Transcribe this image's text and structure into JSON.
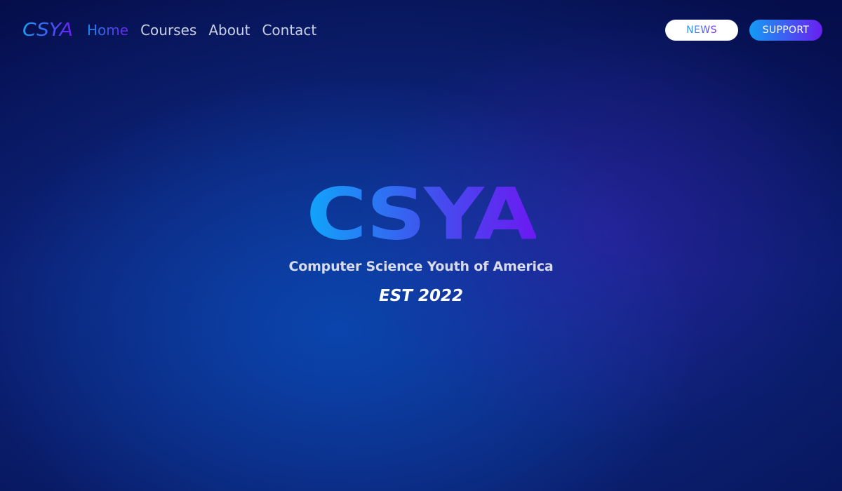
{
  "brand": {
    "logo_text": "CSYA"
  },
  "nav": {
    "links": [
      {
        "label": "Home",
        "active": true
      },
      {
        "label": "Courses",
        "active": false
      },
      {
        "label": "About",
        "active": false
      },
      {
        "label": "Contact",
        "active": false
      }
    ],
    "news_label": "NEWS",
    "support_label": "SUPPORT"
  },
  "hero": {
    "title": "CSYA",
    "subtitle": "Computer Science Youth of America",
    "established": "EST 2022"
  },
  "colors": {
    "background_dark": "#07145a",
    "background_glow": "#0a46af",
    "gradient_start": "#10a6fb",
    "gradient_end": "#6c19f2",
    "nav_text": "#c9d0e3",
    "subtitle_text": "#d8dcea",
    "white": "#ffffff"
  }
}
